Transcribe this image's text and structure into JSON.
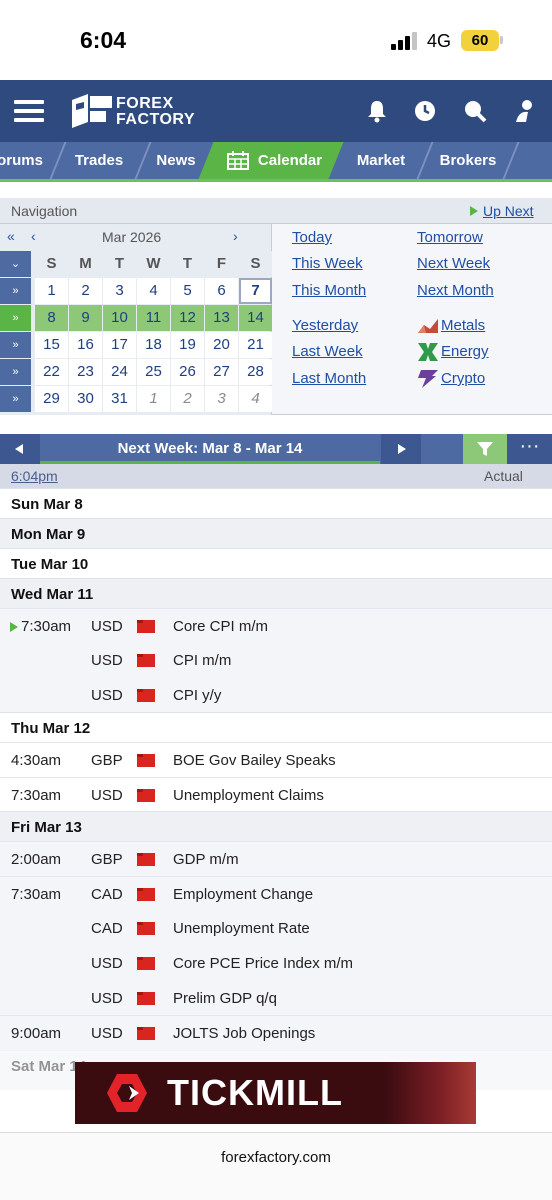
{
  "status": {
    "time": "6:04",
    "network": "4G",
    "battery": "60"
  },
  "header": {
    "logo_line1": "FOREX",
    "logo_line2": "FACTORY"
  },
  "tabs": [
    {
      "label": "orums"
    },
    {
      "label": "Trades"
    },
    {
      "label": "News"
    },
    {
      "label": "Calendar"
    },
    {
      "label": "Market"
    },
    {
      "label": "Brokers"
    }
  ],
  "navigation": {
    "title": "Navigation",
    "up_next": "Up Next"
  },
  "mini_calendar": {
    "prev_year": "«",
    "prev_month": "‹",
    "month": "Mar 2026",
    "next_month": "›",
    "weekdays": [
      "S",
      "M",
      "T",
      "W",
      "T",
      "F",
      "S"
    ],
    "week_toggles": [
      "»",
      "»",
      "»",
      "»",
      "»"
    ],
    "weeks": [
      [
        "1",
        "2",
        "3",
        "4",
        "5",
        "6",
        "7"
      ],
      [
        "8",
        "9",
        "10",
        "11",
        "12",
        "13",
        "14"
      ],
      [
        "15",
        "16",
        "17",
        "18",
        "19",
        "20",
        "21"
      ],
      [
        "22",
        "23",
        "24",
        "25",
        "26",
        "27",
        "28"
      ],
      [
        "29",
        "30",
        "31",
        "1",
        "2",
        "3",
        "4"
      ]
    ]
  },
  "quick_links": {
    "today": "Today",
    "tomorrow": "Tomorrow",
    "this_week": "This Week",
    "next_week": "Next Week",
    "this_month": "This Month",
    "next_month": "Next Month",
    "yesterday": "Yesterday",
    "last_week": "Last Week",
    "last_month": "Last Month",
    "metals": "Metals",
    "energy": "Energy",
    "crypto": "Crypto"
  },
  "week_bar": {
    "title": "Next Week: Mar 8 - Mar 14",
    "more": "···"
  },
  "table_head": {
    "current_time": "6:04pm",
    "actual": "Actual"
  },
  "days": {
    "sun": "Sun Mar 8",
    "mon": "Mon Mar 9",
    "tue": "Tue Mar 10",
    "wed": "Wed Mar 11",
    "thu": "Thu Mar 12",
    "fri": "Fri Mar 13",
    "sat": "Sat Mar 14"
  },
  "events": [
    {
      "time": "7:30am",
      "currency": "USD",
      "name": "Core CPI m/m"
    },
    {
      "time": "",
      "currency": "USD",
      "name": "CPI m/m"
    },
    {
      "time": "",
      "currency": "USD",
      "name": "CPI y/y"
    },
    {
      "time": "4:30am",
      "currency": "GBP",
      "name": "BOE Gov Bailey Speaks"
    },
    {
      "time": "7:30am",
      "currency": "USD",
      "name": "Unemployment Claims"
    },
    {
      "time": "2:00am",
      "currency": "GBP",
      "name": "GDP m/m"
    },
    {
      "time": "7:30am",
      "currency": "CAD",
      "name": "Employment Change"
    },
    {
      "time": "",
      "currency": "CAD",
      "name": "Unemployment Rate"
    },
    {
      "time": "",
      "currency": "USD",
      "name": "Core PCE Price Index m/m"
    },
    {
      "time": "",
      "currency": "USD",
      "name": "Prelim GDP q/q"
    },
    {
      "time": "9:00am",
      "currency": "USD",
      "name": "JOLTS Job Openings"
    }
  ],
  "ad": {
    "text": "TICKMILL"
  },
  "browser": {
    "url": "forexfactory.com"
  },
  "colors": {
    "header": "#2f4a7e",
    "tabs": "#4e6aa3",
    "active_green": "#5ab446",
    "impact_high": "#d8251f",
    "link": "#1e4fa5"
  }
}
